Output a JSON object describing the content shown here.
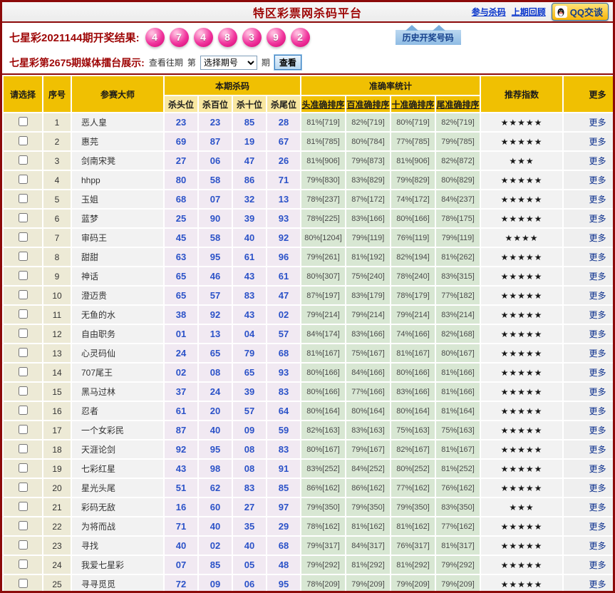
{
  "page": {
    "title": "特区彩票网杀码平台",
    "links": {
      "join": "参与杀码",
      "previous": "上期回顾"
    },
    "qq_button": "QQ交谈"
  },
  "draw": {
    "label": "七星彩2021144期开奖结果:",
    "balls": [
      "4",
      "7",
      "4",
      "8",
      "3",
      "9",
      "2"
    ],
    "history_link": "历史开奖号码"
  },
  "contest": {
    "label": "七星彩第2675期媒体擂台展示:",
    "view_past": "查看往期",
    "di": "第",
    "select_value": "选择期号",
    "qi": "期",
    "view_button": "查看"
  },
  "table": {
    "more_label": "更多",
    "headers": {
      "select": "请选择",
      "seq": "序号",
      "master": "参赛大师",
      "kill_group": "本期杀码",
      "kill_cols": [
        "杀头位",
        "杀百位",
        "杀十位",
        "杀尾位"
      ],
      "acc_group": "准确率统计",
      "acc_cols": [
        "头准确排序",
        "百准确排序",
        "十准确排序",
        "尾准确排序"
      ],
      "stars": "推荐指数",
      "more": "更多"
    },
    "rows": [
      {
        "seq": "1",
        "name": "恶人皇",
        "kills": [
          "23",
          "23",
          "85",
          "28"
        ],
        "stats": [
          "81%[719]",
          "82%[719]",
          "80%[719]",
          "82%[719]"
        ],
        "stars": "★★★★★"
      },
      {
        "seq": "2",
        "name": "惠芫",
        "kills": [
          "69",
          "87",
          "19",
          "67"
        ],
        "stats": [
          "81%[785]",
          "80%[784]",
          "77%[785]",
          "79%[785]"
        ],
        "stars": "★★★★★"
      },
      {
        "seq": "3",
        "name": "剑南宋凳",
        "kills": [
          "27",
          "06",
          "47",
          "26"
        ],
        "stats": [
          "81%[906]",
          "79%[873]",
          "81%[906]",
          "82%[872]"
        ],
        "stars": "★★★"
      },
      {
        "seq": "4",
        "name": "hhpp",
        "kills": [
          "80",
          "58",
          "86",
          "71"
        ],
        "stats": [
          "79%[830]",
          "83%[829]",
          "79%[829]",
          "80%[829]"
        ],
        "stars": "★★★★★"
      },
      {
        "seq": "5",
        "name": "玉姐",
        "kills": [
          "68",
          "07",
          "32",
          "13"
        ],
        "stats": [
          "78%[237]",
          "87%[172]",
          "74%[172]",
          "84%[237]"
        ],
        "stars": "★★★★★"
      },
      {
        "seq": "6",
        "name": "蓝梦",
        "kills": [
          "25",
          "90",
          "39",
          "93"
        ],
        "stats": [
          "78%[225]",
          "83%[166]",
          "80%[166]",
          "78%[175]"
        ],
        "stars": "★★★★★"
      },
      {
        "seq": "7",
        "name": "审码王",
        "kills": [
          "45",
          "58",
          "40",
          "92"
        ],
        "stats": [
          "80%[1204]",
          "79%[119]",
          "76%[119]",
          "79%[119]"
        ],
        "stars": "★★★★"
      },
      {
        "seq": "8",
        "name": "甜甜",
        "kills": [
          "63",
          "95",
          "61",
          "96"
        ],
        "stats": [
          "79%[261]",
          "81%[192]",
          "82%[194]",
          "81%[262]"
        ],
        "stars": "★★★★★"
      },
      {
        "seq": "9",
        "name": "神话",
        "kills": [
          "65",
          "46",
          "43",
          "61"
        ],
        "stats": [
          "80%[307]",
          "75%[240]",
          "78%[240]",
          "83%[315]"
        ],
        "stars": "★★★★★"
      },
      {
        "seq": "10",
        "name": "澄迈贵",
        "kills": [
          "65",
          "57",
          "83",
          "47"
        ],
        "stats": [
          "87%[197]",
          "83%[179]",
          "78%[179]",
          "77%[182]"
        ],
        "stars": "★★★★★"
      },
      {
        "seq": "11",
        "name": "无鱼的水",
        "kills": [
          "38",
          "92",
          "43",
          "02"
        ],
        "stats": [
          "79%[214]",
          "79%[214]",
          "79%[214]",
          "83%[214]"
        ],
        "stars": "★★★★★"
      },
      {
        "seq": "12",
        "name": "自由职务",
        "kills": [
          "01",
          "13",
          "04",
          "57"
        ],
        "stats": [
          "84%[174]",
          "83%[166]",
          "74%[166]",
          "82%[168]"
        ],
        "stars": "★★★★★"
      },
      {
        "seq": "13",
        "name": "心灵码仙",
        "kills": [
          "24",
          "65",
          "79",
          "68"
        ],
        "stats": [
          "81%[167]",
          "75%[167]",
          "81%[167]",
          "80%[167]"
        ],
        "stars": "★★★★★"
      },
      {
        "seq": "14",
        "name": "707尾王",
        "kills": [
          "02",
          "08",
          "65",
          "93"
        ],
        "stats": [
          "80%[166]",
          "84%[166]",
          "80%[166]",
          "81%[166]"
        ],
        "stars": "★★★★★"
      },
      {
        "seq": "15",
        "name": "黑马过林",
        "kills": [
          "37",
          "24",
          "39",
          "83"
        ],
        "stats": [
          "80%[166]",
          "77%[166]",
          "83%[166]",
          "81%[166]"
        ],
        "stars": "★★★★★"
      },
      {
        "seq": "16",
        "name": "忍者",
        "kills": [
          "61",
          "20",
          "57",
          "64"
        ],
        "stats": [
          "80%[164]",
          "80%[164]",
          "80%[164]",
          "81%[164]"
        ],
        "stars": "★★★★★"
      },
      {
        "seq": "17",
        "name": "一个女彩民",
        "kills": [
          "87",
          "40",
          "09",
          "59"
        ],
        "stats": [
          "82%[163]",
          "83%[163]",
          "75%[163]",
          "75%[163]"
        ],
        "stars": "★★★★★"
      },
      {
        "seq": "18",
        "name": "天涯论剑",
        "kills": [
          "92",
          "95",
          "08",
          "83"
        ],
        "stats": [
          "80%[167]",
          "79%[167]",
          "82%[167]",
          "81%[167]"
        ],
        "stars": "★★★★★"
      },
      {
        "seq": "19",
        "name": "七彩红星",
        "kills": [
          "43",
          "98",
          "08",
          "91"
        ],
        "stats": [
          "83%[252]",
          "84%[252]",
          "80%[252]",
          "81%[252]"
        ],
        "stars": "★★★★★"
      },
      {
        "seq": "20",
        "name": "星光头尾",
        "kills": [
          "51",
          "62",
          "83",
          "85"
        ],
        "stats": [
          "86%[162]",
          "86%[162]",
          "77%[162]",
          "76%[162]"
        ],
        "stars": "★★★★★"
      },
      {
        "seq": "21",
        "name": "彩码无敌",
        "kills": [
          "16",
          "60",
          "27",
          "97"
        ],
        "stats": [
          "79%[350]",
          "79%[350]",
          "79%[350]",
          "83%[350]"
        ],
        "stars": "★★★"
      },
      {
        "seq": "22",
        "name": "为将而战",
        "kills": [
          "71",
          "40",
          "35",
          "29"
        ],
        "stats": [
          "78%[162]",
          "81%[162]",
          "81%[162]",
          "77%[162]"
        ],
        "stars": "★★★★★"
      },
      {
        "seq": "23",
        "name": "寻找",
        "kills": [
          "40",
          "02",
          "40",
          "68"
        ],
        "stats": [
          "79%[317]",
          "84%[317]",
          "76%[317]",
          "81%[317]"
        ],
        "stars": "★★★★★"
      },
      {
        "seq": "24",
        "name": "我爱七星彩",
        "kills": [
          "07",
          "85",
          "05",
          "48"
        ],
        "stats": [
          "79%[292]",
          "81%[292]",
          "81%[292]",
          "79%[292]"
        ],
        "stars": "★★★★★"
      },
      {
        "seq": "25",
        "name": "寻寻觅觅",
        "kills": [
          "72",
          "09",
          "06",
          "95"
        ],
        "stats": [
          "78%[209]",
          "79%[209]",
          "79%[209]",
          "79%[209]"
        ],
        "stars": "★★★★★"
      }
    ]
  }
}
